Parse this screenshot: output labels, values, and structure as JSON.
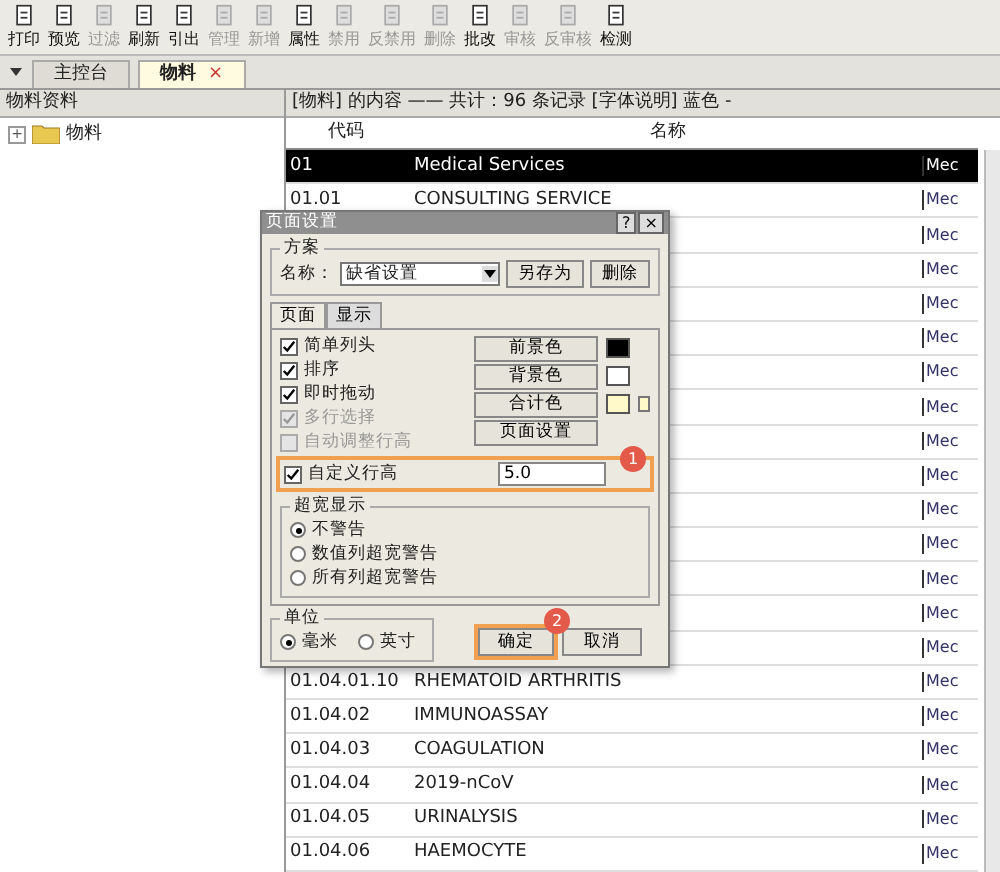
{
  "toolbar": [
    {
      "label": "打印",
      "disabled": false
    },
    {
      "label": "预览",
      "disabled": false
    },
    {
      "label": "过滤",
      "disabled": true
    },
    {
      "label": "刷新",
      "disabled": false
    },
    {
      "label": "引出",
      "disabled": false
    },
    {
      "label": "管理",
      "disabled": true
    },
    {
      "label": "新增",
      "disabled": true
    },
    {
      "label": "属性",
      "disabled": false
    },
    {
      "label": "禁用",
      "disabled": true
    },
    {
      "label": "反禁用",
      "disabled": true
    },
    {
      "label": "删除",
      "disabled": true
    },
    {
      "label": "批改",
      "disabled": false
    },
    {
      "label": "审核",
      "disabled": true
    },
    {
      "label": "反审核",
      "disabled": true
    },
    {
      "label": "检测",
      "disabled": false
    }
  ],
  "tabs": [
    {
      "label": "主控台",
      "selected": false,
      "closable": false
    },
    {
      "label": "物料",
      "selected": true,
      "closable": true
    }
  ],
  "tab_close": "×",
  "left_panel": {
    "title": "物料资料",
    "tree": [
      {
        "label": "物料",
        "expanded": false,
        "toggle": "+"
      }
    ]
  },
  "content": {
    "caption": "[物料] 的内容 —— 共计：96 条记录 [字体说明] 蓝色 -",
    "columns": [
      "代码",
      "名称"
    ],
    "rows": [
      {
        "code": "01",
        "name": "Medical Services",
        "column_3": "Mec",
        "selected": true
      },
      {
        "code": "01.01",
        "name": "CONSULTING SERVICE",
        "column_3": "Mec",
        "selected": false
      },
      {
        "column_3": "Mec",
        "selected": false
      },
      {
        "column_3": "Mec",
        "selected": false
      },
      {
        "column_3": "Mec",
        "selected": false
      },
      {
        "column_3": "Mec",
        "selected": false
      },
      {
        "column_3": "Mec",
        "selected": false
      },
      {
        "column_3": "Mec",
        "selected": false
      },
      {
        "column_3": "Mec",
        "selected": false
      },
      {
        "column_3": "Mec",
        "selected": false
      },
      {
        "column_3": "Mec",
        "selected": false
      },
      {
        "column_3": "Mec",
        "selected": false
      },
      {
        "column_3": "Mec",
        "selected": false
      },
      {
        "column_3": "Mec",
        "selected": false
      },
      {
        "column_3": "Mec",
        "selected": false
      },
      {
        "code": "01.04.01.10",
        "name": "RHEMATOID ARTHRITIS",
        "column_3": "Mec",
        "selected": false
      },
      {
        "code": "01.04.02",
        "name": "IMMUNOASSAY",
        "column_3": "Mec",
        "selected": false
      },
      {
        "code": "01.04.03",
        "name": "COAGULATION",
        "column_3": "Mec",
        "selected": false
      },
      {
        "code": "01.04.04",
        "name": "2019-nCoV",
        "column_3": "Mec",
        "selected": false
      },
      {
        "code": "01.04.05",
        "name": "URINALYSIS",
        "column_3": "Mec",
        "selected": false
      },
      {
        "code": "01.04.06",
        "name": "HAEMOCYTE",
        "column_3": "Mec",
        "selected": false
      }
    ]
  },
  "dialog": {
    "title": "页面设置",
    "help": "?",
    "close": "×",
    "scheme": {
      "title": "方案",
      "name_label": "名称：",
      "name_value": "缺省设置",
      "save_as": "另存为",
      "delete": "删除"
    },
    "tabs": [
      {
        "label": "页面",
        "selected": true
      },
      {
        "label": "显示",
        "selected": false
      }
    ],
    "options": [
      {
        "label": "简单列头",
        "checked": true,
        "disabled": false
      },
      {
        "label": "排序",
        "checked": true,
        "disabled": false
      },
      {
        "label": "即时拖动",
        "checked": true,
        "disabled": false
      },
      {
        "label": "多行选择",
        "checked": true,
        "disabled": true
      },
      {
        "label": "自动调整行高",
        "checked": false,
        "disabled": true
      }
    ],
    "color_buttons": [
      {
        "label": "前景色",
        "color": "#000000",
        "extra_box": false
      },
      {
        "label": "背景色",
        "color": "#ffffff",
        "extra_box": false
      },
      {
        "label": "合计色",
        "color": "#fff8c8",
        "extra_box": true
      },
      {
        "label": "页面设置"
      }
    ],
    "row_height": {
      "label": "自定义行高",
      "checked": true,
      "value": "5.0",
      "highlighted": true,
      "badge": "1"
    },
    "overflow": {
      "title": "超宽显示",
      "options": [
        {
          "label": "不警告",
          "selected": true
        },
        {
          "label": "数值列超宽警告",
          "selected": false
        },
        {
          "label": "所有列超宽警告",
          "selected": false
        }
      ]
    },
    "unit": {
      "title": "单位",
      "options": [
        {
          "label": "毫米",
          "selected": true
        },
        {
          "label": "英寸",
          "selected": false
        }
      ]
    },
    "ok": {
      "label": "确定",
      "highlighted": true,
      "badge": "2"
    },
    "cancel": "取消"
  }
}
